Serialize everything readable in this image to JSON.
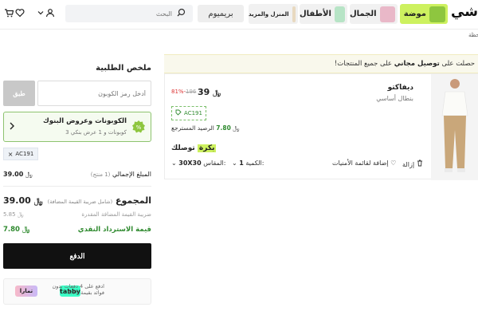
{
  "header": {
    "logo": "شي",
    "search_placeholder": "البحث",
    "premium": "بريميوم",
    "tiles": [
      {
        "label": "موضة",
        "bg": "#cdf15f"
      },
      {
        "label": "الجمال",
        "bg": "#f1f1f1"
      },
      {
        "label": "الأطفال",
        "bg": "#f1f1f1"
      },
      {
        "label": "المنزل والمزيد",
        "bg": "#f1f1f1"
      }
    ],
    "subnav": "ملاحظة"
  },
  "banner": {
    "prefix": "حصلت على",
    "highlight": "توصيل مجاني",
    "suffix": "على جميع المنتجات!"
  },
  "product": {
    "brand": "ديفاكتو",
    "name": "بنطال أساسي",
    "price": "39",
    "old_price": "196",
    "discount": "81%-",
    "coupon_code": "AC191",
    "points_label": "الرصيد المسترجع",
    "points_value": "7.80",
    "delivery_label": "توصلك",
    "delivery_day": "بكرة",
    "size_label": "المقاس:",
    "size_value": "30X30",
    "qty_label": "الكمية:",
    "qty_value": "1",
    "wishlist_label": "إضافة لقائمة الأمنيات",
    "remove_label": "إزالة"
  },
  "summary": {
    "title": "ملخص الطلبية",
    "coupon_placeholder": "أدخل رمز الكوبون",
    "apply_label": "طبق",
    "offers_title": "الكوبونات وعروض البنوك",
    "offers_sub": "3 كوبونات و 1 عرض بنكي",
    "applied_code": "AC191",
    "subtotal_label": "المبلغ الإجمالي",
    "subtotal_note": "(1 منتج)",
    "subtotal_value": "39.00",
    "total_label": "المجموع",
    "total_note": "(شامل ضريبة القيمة المضافة)",
    "total_value": "39.00",
    "vat_label": "ضريبة القيمة المضافة المقدرة",
    "vat_value": "5.85",
    "cashback_label": "قيمة الاسترداد النقدي",
    "cashback_value": "7.80",
    "pay_label": "الدفع",
    "tabby_line1": "ادفع على 4 دفعات بدون",
    "tabby_line2": "فوائد بقيمة 9.75",
    "tabby_logo": "tabby",
    "tamara_logo": "تمارا"
  },
  "colors": {
    "accent_green": "#cdf15f",
    "success_green": "#2f8a2f",
    "discount_red": "#d33"
  }
}
